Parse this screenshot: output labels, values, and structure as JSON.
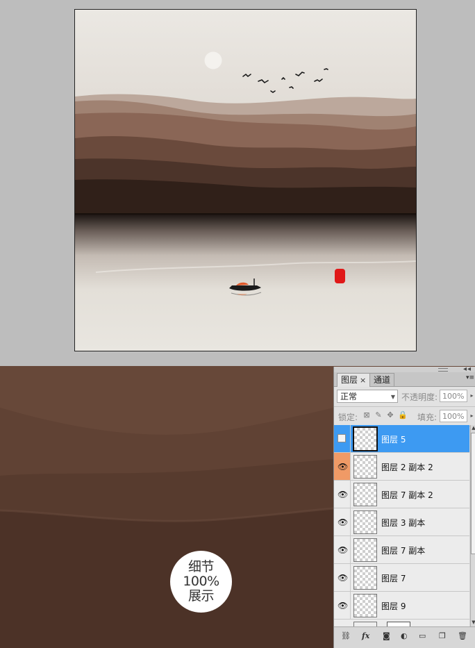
{
  "badge": {
    "line1": "细节",
    "line2": "100%",
    "line3": "展示"
  },
  "panel": {
    "tabs": [
      {
        "label": "图层",
        "active": true
      },
      {
        "label": "通道",
        "active": false
      }
    ],
    "close_symbol": "×",
    "blend_mode": "正常",
    "opacity_label": "不透明度:",
    "opacity_value": "100%",
    "lock_label": "锁定:",
    "fill_label": "填充:",
    "fill_value": "100%"
  },
  "layers": [
    {
      "name": "图层 5",
      "selected": true,
      "visible": false
    },
    {
      "name": "图层 2 副本 2",
      "selected": false,
      "visible": true,
      "highlight": true
    },
    {
      "name": "图层 7 副本 2",
      "selected": false,
      "visible": true
    },
    {
      "name": "图层 3 副本",
      "selected": false,
      "visible": true
    },
    {
      "name": "图层 7 副本",
      "selected": false,
      "visible": true
    },
    {
      "name": "图层 7",
      "selected": false,
      "visible": true
    },
    {
      "name": "图层 9",
      "selected": false,
      "visible": true
    }
  ],
  "icons": {
    "eye": "eye-icon",
    "link": "link-layers-icon",
    "fx": "fx-icon",
    "mask": "add-mask-icon",
    "adjust": "adjustment-layer-icon",
    "group": "new-group-icon",
    "new": "new-layer-icon",
    "delete": "trash-icon"
  },
  "colors": {
    "selected_row": "#3d9af2",
    "visibility_highlight": "#f09a66",
    "seal": "#e01818"
  },
  "fx_label": "fx"
}
